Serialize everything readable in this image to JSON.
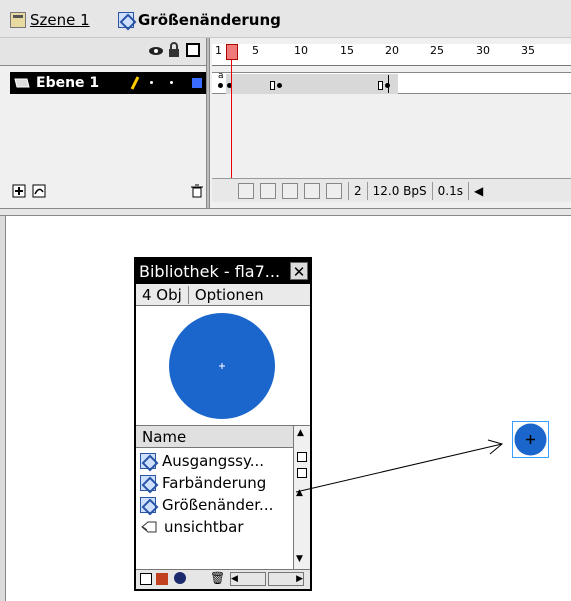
{
  "breadcrumb": {
    "scene_label": "Szene 1",
    "symbol_label": "Größenänderung"
  },
  "timeline": {
    "layer_name": "Ebene 1",
    "ruler_ticks": [
      "1",
      "5",
      "10",
      "15",
      "20",
      "25",
      "30",
      "35"
    ],
    "keyframe_marker": "a",
    "current_frame": "2",
    "fps": "12.0 BpS",
    "time": "0.1s"
  },
  "library": {
    "title": "Bibliothek - fla7...",
    "count": "4 Obj",
    "options_label": "Optionen",
    "name_header": "Name",
    "items": [
      {
        "label": "Ausgangssy...",
        "icon": "movieclip-icon"
      },
      {
        "label": "Farbänderung",
        "icon": "movieclip-icon"
      },
      {
        "label": "Größenänder...",
        "icon": "movieclip-icon"
      },
      {
        "label": "unsichtbar",
        "icon": "button-icon"
      }
    ],
    "preview_color": "#1a66cc"
  },
  "colors": {
    "circle_blue": "#1a66cc",
    "selection_blue": "#3aa0ff",
    "playhead_red": "#e00000"
  }
}
